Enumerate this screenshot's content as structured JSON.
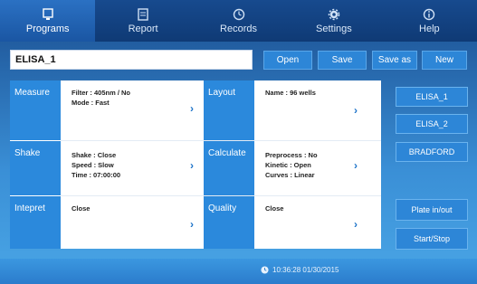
{
  "nav": {
    "tabs": [
      {
        "label": "Programs",
        "icon": "monitor-icon",
        "active": true
      },
      {
        "label": "Report",
        "icon": "report-icon",
        "active": false
      },
      {
        "label": "Records",
        "icon": "clock-icon",
        "active": false
      },
      {
        "label": "Settings",
        "icon": "gear-icon",
        "active": false
      },
      {
        "label": "Help",
        "icon": "info-icon",
        "active": false
      }
    ]
  },
  "toolbar": {
    "program_name": "ELISA_1",
    "open_label": "Open",
    "save_label": "Save",
    "save_as_label": "Save as",
    "new_label": "New"
  },
  "panel": {
    "measure": {
      "label": "Measure",
      "lines": [
        "Filter :  405nm / No",
        "Mode :  Fast"
      ]
    },
    "layout": {
      "label": "Layout",
      "lines": [
        "Name :  96 wells"
      ]
    },
    "shake": {
      "label": "Shake",
      "lines": [
        "Shake : Close",
        "Speed : Slow",
        "Time :  07:00:00"
      ]
    },
    "calculate": {
      "label": "Calculate",
      "lines": [
        "Preprocess : No",
        "Kinetic :  Open",
        "Curves : Linear"
      ]
    },
    "intepret": {
      "label": "Intepret",
      "lines": [
        "Close"
      ]
    },
    "quality": {
      "label": "Quality",
      "lines": [
        "Close"
      ]
    }
  },
  "side": {
    "programs": [
      "ELISA_1",
      "ELISA_2",
      "BRADFORD"
    ],
    "plate_label": "Plate in/out",
    "startstop_label": "Start/Stop"
  },
  "status": {
    "datetime": "10:36:28  01/30/2015"
  },
  "colors": {
    "accent": "#2b89dc",
    "nav_bg": "#0f3a75",
    "active_tab": "#1a56a3"
  }
}
